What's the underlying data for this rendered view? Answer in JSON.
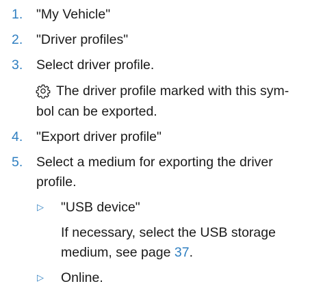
{
  "steps": [
    {
      "number": "1.",
      "text": "\"My Vehicle\""
    },
    {
      "number": "2.",
      "text": "\"Driver profiles\""
    },
    {
      "number": "3.",
      "text": "Select driver profile."
    },
    {
      "number": "4.",
      "text": "\"Export driver profile\""
    },
    {
      "number": "5.",
      "text_line1": "Select a medium for exporting the driver",
      "text_line2": "profile."
    }
  ],
  "step3_note": {
    "icon": "gear-icon",
    "line1": "The driver profile marked with this sym-",
    "line2": "bol can be exported."
  },
  "sub_items": [
    {
      "marker": "▷",
      "text": "\"USB device\""
    },
    {
      "marker": "▷",
      "text": "Online."
    }
  ],
  "usb_note": {
    "line1": "If necessary, select the USB storage",
    "line2_prefix": "medium, see page ",
    "page_link": "37",
    "line2_suffix": "."
  },
  "colors": {
    "accent": "#2f7fc1",
    "text": "#1a1a1a"
  }
}
